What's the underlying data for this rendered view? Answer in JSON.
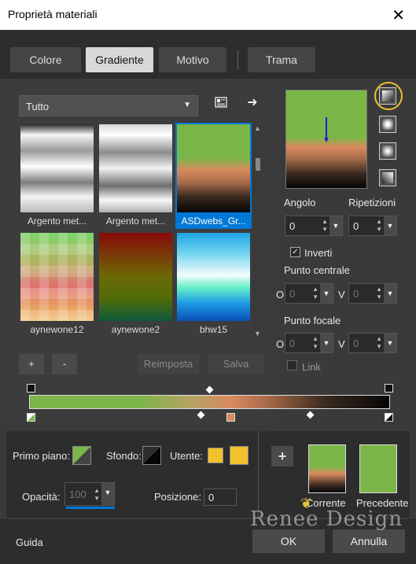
{
  "window": {
    "title": "Proprietà materiali",
    "close_glyph": "✕"
  },
  "tabs": [
    {
      "label": "Colore",
      "active": false
    },
    {
      "label": "Gradiente",
      "active": true
    },
    {
      "label": "Motivo",
      "active": false
    },
    {
      "label": "Trama",
      "active": false
    }
  ],
  "library": {
    "category": "Tutto",
    "swatches": [
      {
        "label": "Argento met...",
        "selected": false
      },
      {
        "label": "Argento met...",
        "selected": false
      },
      {
        "label": "ASDwebs_Gr...",
        "selected": true
      },
      {
        "label": "aynewone12",
        "selected": false
      },
      {
        "label": "aynewone2",
        "selected": false
      },
      {
        "label": "bhw15",
        "selected": false
      }
    ],
    "add_label": "+",
    "remove_label": "-",
    "reset_label": "Reimposta",
    "save_label": "Salva"
  },
  "settings": {
    "angle_label": "Angolo",
    "angle_value": "0",
    "repeat_label": "Ripetizioni",
    "repeat_value": "0",
    "invert_label": "Inverti",
    "invert_checked": true,
    "center_label": "Punto centrale",
    "focal_label": "Punto focale",
    "h_label": "O",
    "v_label": "V",
    "center_h": "0",
    "center_v": "0",
    "focal_h": "0",
    "focal_v": "0",
    "link_label": "Link",
    "link_checked": false
  },
  "materials": {
    "foreground_label": "Primo piano:",
    "background_label": "Sfondo:",
    "user_label": "Utente:",
    "opacity_label": "Opacità:",
    "opacity_value": "100",
    "position_label": "Posizione:",
    "position_value": "0",
    "current_label": "Corrente",
    "previous_label": "Precedente",
    "add_label": "+"
  },
  "footer": {
    "help_label": "Guida",
    "ok_label": "OK",
    "cancel_label": "Annulla",
    "watermark": "Renee Design"
  },
  "colors": {
    "green": "#7ab648",
    "salmon": "#d98a5e",
    "black": "#060606",
    "user_yellow": "#f2c12e",
    "accent_blue": "#0078d7",
    "highlight_ring": "#f0c030"
  }
}
